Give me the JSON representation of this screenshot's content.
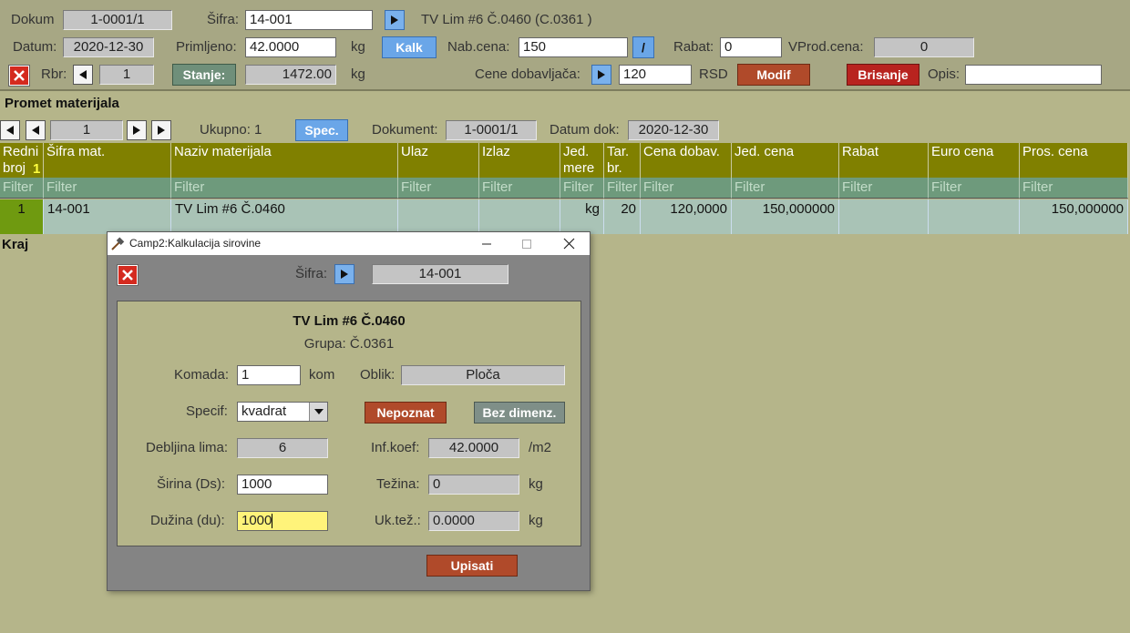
{
  "header": {
    "dokum_label": "Dokum",
    "dokum_value": "1-0001/1",
    "sifra_label": "Šifra:",
    "sifra_value": "14-001",
    "item_title": "TV Lim #6 Č.0460 (C.0361 )",
    "datum_label": "Datum:",
    "datum_value": "2020-12-30",
    "primljeno_label": "Primljeno:",
    "primljeno_value": "42.0000",
    "kg1": "kg",
    "kalk_label": "Kalk",
    "nabcena_label": "Nab.cena:",
    "nabcena_value": "150",
    "slash_label": "/",
    "rabat_label": "Rabat:",
    "rabat_value": "0",
    "vprod_label": "VProd.cena:",
    "vprod_value": "0",
    "rbr_label": "Rbr:",
    "rbr_value": "1",
    "stanje_label": "Stanje:",
    "stanje_value": "1472.00",
    "kg2": "kg",
    "cene_label": "Cene dobavljača:",
    "cene_value": "120",
    "rsd_label": "RSD",
    "modif_label": "Modif",
    "brisanje_label": "Brisanje",
    "opis_label": "Opis:",
    "opis_value": ""
  },
  "section": {
    "title": "Promet materijala",
    "page_value": "1",
    "ukupno": "Ukupno: 1",
    "spec_label": "Spec.",
    "dokument_label": "Dokument:",
    "dokument_value": "1-0001/1",
    "datumdok_label": "Datum dok:",
    "datumdok_value": "2020-12-30"
  },
  "grid": {
    "columns": [
      "Redni broj",
      "Šifra mat.",
      "Naziv materijala",
      "Ulaz",
      "Izlaz",
      "Jed. mere",
      "Tar. br.",
      "Cena dobav.",
      "Jed. cena",
      "Rabat",
      "Euro cena",
      "Pros. cena"
    ],
    "sort_indicator": "1",
    "filter_text": "Filter",
    "row": [
      "1",
      "14-001",
      "TV Lim #6 Č.0460",
      "",
      "",
      "kg",
      "20",
      "120,0000",
      "150,000000",
      "",
      "",
      "150,000000"
    ]
  },
  "footer_label": "Kraj",
  "modal": {
    "title": "Camp2:Kalkulacija sirovine",
    "sifra_label": "Šifra:",
    "sifra_value": "14-001",
    "name": "TV Lim #6 Č.0460",
    "grupa": "Grupa: Č.0361",
    "komada_label": "Komada:",
    "komada_value": "1",
    "kom_unit": "kom",
    "oblik_label": "Oblik:",
    "oblik_value": "Ploča",
    "specif_label": "Specif:",
    "specif_value": "kvadrat",
    "nepoznat_label": "Nepoznat",
    "bezdim_label": "Bez dimenz.",
    "debljina_label": "Debljina lima:",
    "debljina_value": "6",
    "infkoef_label": "Inf.koef:",
    "infkoef_value": "42.0000",
    "m2_unit": "/m2",
    "sirina_label": "Širina (Ds):",
    "sirina_value": "1000",
    "tezina_label": "Težina:",
    "tezina_value": "0",
    "kg_unit1": "kg",
    "duzina_label": "Dužina (du):",
    "duzina_value": "1000",
    "uktez_label": "Uk.tež.:",
    "uktez_value": "0.0000",
    "kg_unit2": "kg",
    "upisati_label": "Upisati"
  },
  "colors": {
    "background": "#b5b58a",
    "grid_header": "#808000",
    "grid_filter": "#6e9a7c",
    "grid_row": "#a9c3b6",
    "selected_cell": "#6f9a10",
    "active_field": "#fff37a"
  }
}
